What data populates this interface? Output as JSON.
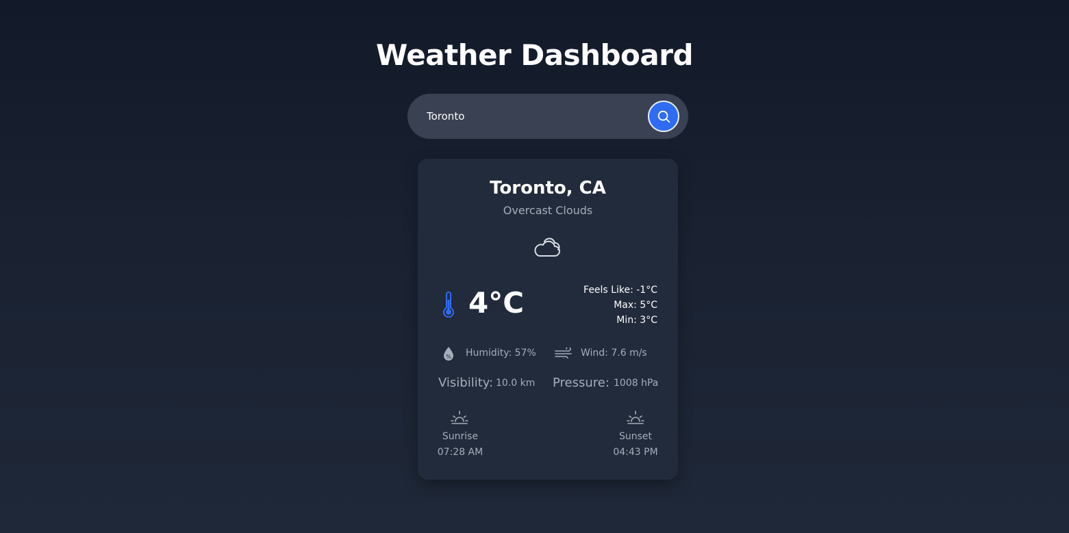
{
  "header": {
    "title": "Weather Dashboard"
  },
  "search": {
    "value": "Toronto",
    "placeholder": ""
  },
  "weather": {
    "city": "Toronto, CA",
    "condition": "Overcast Clouds",
    "temperature": "4°C",
    "feels_like": "Feels Like: -1°C",
    "max": "Max: 5°C",
    "min": "Min: 3°C",
    "humidity": "Humidity: 57%",
    "wind": "Wind: 7.6 m/s",
    "visibility_label": "Visibility:",
    "visibility_value": "10.0 km",
    "pressure_label": "Pressure:",
    "pressure_value": "1008 hPa",
    "sunrise_label": "Sunrise",
    "sunrise_time": "07:28 AM",
    "sunset_label": "Sunset",
    "sunset_time": "04:43 PM"
  },
  "icons": {
    "search": "search-icon",
    "weather": "cloud-icon",
    "temperature": "thermometer-icon",
    "humidity": "humidity-drop-icon",
    "wind": "wind-icon",
    "sunrise": "sunrise-icon",
    "sunset": "sunset-icon"
  },
  "colors": {
    "accent": "#2f6cf1",
    "card": "#222b3b",
    "muted_text": "#a6adbb",
    "search_bg": "#3a4152"
  }
}
